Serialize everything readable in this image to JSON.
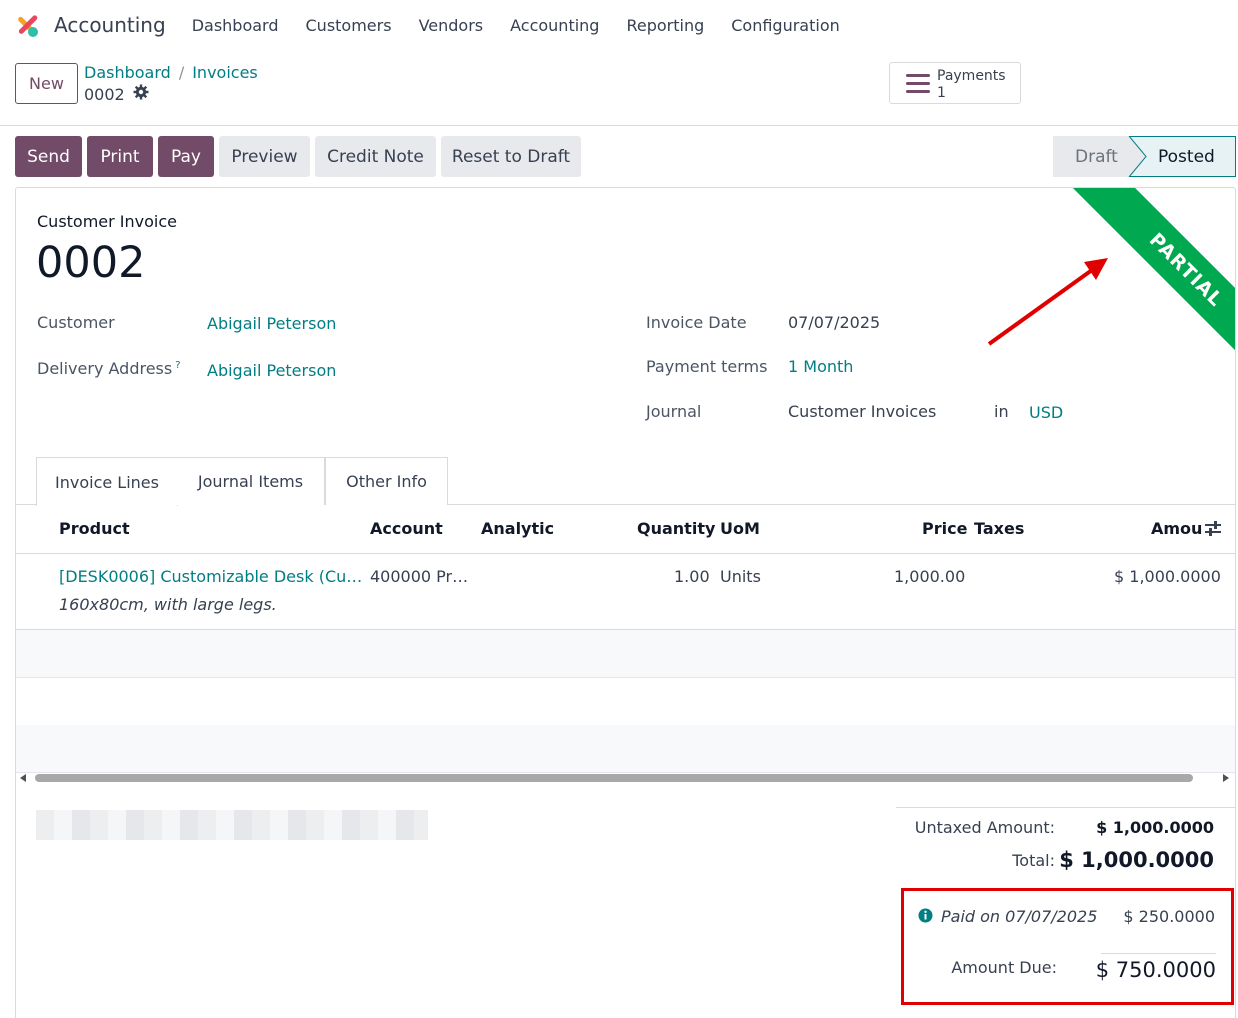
{
  "app": {
    "title": "Accounting",
    "menu": [
      "Dashboard",
      "Customers",
      "Vendors",
      "Accounting",
      "Reporting",
      "Configuration"
    ]
  },
  "control": {
    "new_label": "New",
    "breadcrumb": [
      "Dashboard",
      "Invoices"
    ],
    "breadcrumb_sep": "/",
    "record_name": "0002",
    "smart_button": {
      "label": "Payments",
      "count": "1"
    }
  },
  "actions": {
    "send": "Send",
    "print": "Print",
    "pay": "Pay",
    "preview": "Preview",
    "credit_note": "Credit Note",
    "reset": "Reset to Draft"
  },
  "status": {
    "draft": "Draft",
    "posted": "Posted"
  },
  "ribbon": {
    "text": "PARTIAL",
    "color": "#00a94f"
  },
  "form": {
    "doc_type": "Customer Invoice",
    "doc_name": "0002",
    "customer_label": "Customer",
    "customer_value": "Abigail Peterson",
    "delivery_label": "Delivery Address",
    "delivery_help": "?",
    "delivery_value": "Abigail Peterson",
    "invoice_date_label": "Invoice Date",
    "invoice_date_value": "07/07/2025",
    "payment_terms_label": "Payment terms",
    "payment_terms_value": "1 Month",
    "journal_label": "Journal",
    "journal_value": "Customer Invoices",
    "journal_in": "in",
    "currency": "USD"
  },
  "tabs": [
    "Invoice Lines",
    "Journal Items",
    "Other Info"
  ],
  "lines": {
    "headers": [
      "Product",
      "Account",
      "Analytic",
      "Quantity",
      "UoM",
      "Price",
      "Taxes",
      "Amou"
    ],
    "rows": [
      {
        "product": "[DESK0006] Customizable Desk (Cu…",
        "description": "160x80cm, with large legs.",
        "account": "400000 Pr…",
        "analytic": "",
        "quantity": "1.00",
        "uom": "Units",
        "price": "1,000.00",
        "taxes": "",
        "amount": "$ 1,000.0000"
      }
    ]
  },
  "totals": {
    "untaxed_label": "Untaxed Amount:",
    "untaxed_value": "$ 1,000.0000",
    "total_label": "Total:",
    "total_value": "$ 1,000.0000",
    "paid_label": "Paid on 07/07/2025",
    "paid_value": "$ 250.0000",
    "due_label": "Amount Due:",
    "due_value": "$ 750.0000"
  },
  "colors": {
    "brand": "#714b67",
    "link": "#017e84",
    "annotation": "#e00000"
  }
}
